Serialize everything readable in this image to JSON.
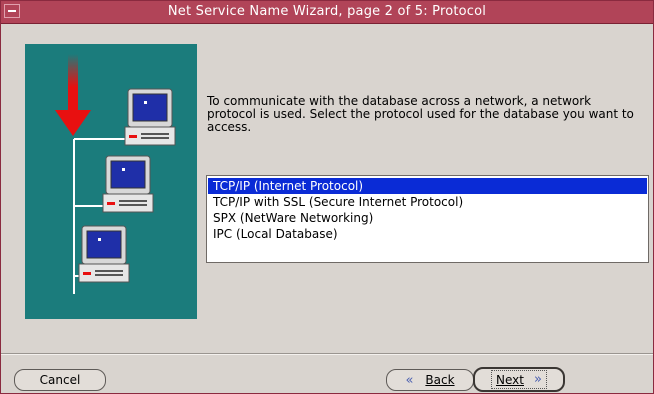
{
  "window": {
    "title": "Net Service Name Wizard, page 2 of 5: Protocol"
  },
  "description": "To communicate with the database across a network, a network protocol is used.  Select the protocol used for the database you want to access.",
  "protocols": [
    {
      "label": "TCP/IP (Internet Protocol)",
      "selected": true
    },
    {
      "label": "TCP/IP with SSL (Secure Internet Protocol)",
      "selected": false
    },
    {
      "label": "SPX (NetWare Networking)",
      "selected": false
    },
    {
      "label": "IPC (Local Database)",
      "selected": false
    }
  ],
  "buttons": {
    "cancel": "Cancel",
    "back": "Back",
    "next": "Next",
    "back_icon": "«",
    "next_icon": "»"
  },
  "colors": {
    "titlebar": "#b14458",
    "graphic_background": "#1b7c7c",
    "selection": "#0a2bd6",
    "arrow": "#e81010"
  },
  "icons": [
    "window-menu-icon",
    "network-illustration",
    "back-chevron-icon",
    "next-chevron-icon"
  ]
}
